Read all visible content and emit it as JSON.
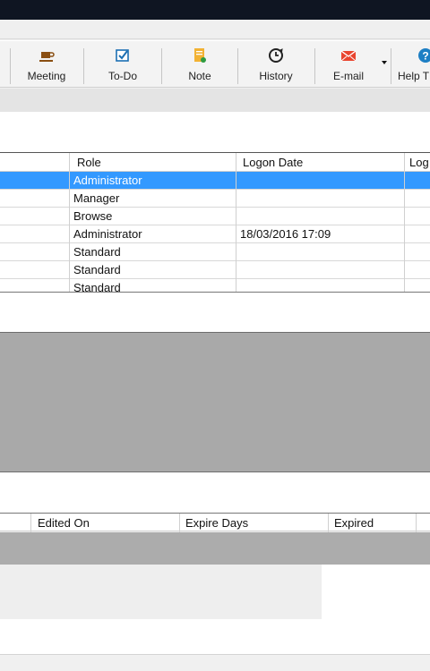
{
  "toolbar": {
    "buttons": [
      {
        "label": "Meeting",
        "icon": "coffee-cup-icon"
      },
      {
        "label": "To-Do",
        "icon": "checkbox-icon"
      },
      {
        "label": "Note",
        "icon": "note-icon"
      },
      {
        "label": "History",
        "icon": "history-clock-icon"
      },
      {
        "label": "E-mail",
        "icon": "envelope-icon"
      },
      {
        "label": "Help T",
        "icon": "help-icon"
      }
    ]
  },
  "users_grid": {
    "columns": [
      "Role",
      "Logon Date",
      "Log"
    ],
    "rows": [
      {
        "role": "Administrator",
        "logon_date": "",
        "selected": true
      },
      {
        "role": "Manager",
        "logon_date": ""
      },
      {
        "role": "Browse",
        "logon_date": ""
      },
      {
        "role": "Administrator",
        "logon_date": "18/03/2016 17:09"
      },
      {
        "role": "Standard",
        "logon_date": ""
      },
      {
        "role": "Standard",
        "logon_date": ""
      },
      {
        "role": "Standard",
        "logon_date": ""
      }
    ]
  },
  "second_grid": {
    "columns": [
      "Edited On",
      "Expire Days",
      "Expired"
    ]
  },
  "colors": {
    "selection": "#3399ff",
    "panel_gray": "#a9a9a9",
    "titlebar": "#0f1522"
  }
}
